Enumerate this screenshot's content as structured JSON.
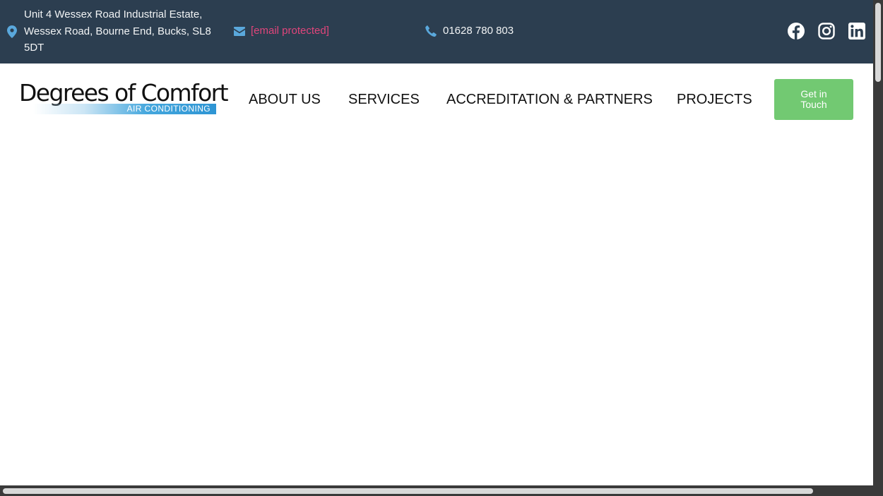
{
  "topbar": {
    "address": "Unit 4 Wessex Road Industrial Estate, Wessex Road, Bourne End, Bucks, SL8 5DT",
    "email": "[email protected]",
    "phone": "01628 780 803",
    "social": [
      "facebook-icon",
      "instagram-icon",
      "linkedin-icon"
    ]
  },
  "logo": {
    "name": "Degrees of Comfort",
    "tagline": "AIR CONDITIONING"
  },
  "nav": {
    "items": [
      "ABOUT US",
      "SERVICES",
      "ACCREDITATION & PARTNERS",
      "PROJECTS"
    ],
    "cta": "Get in Touch"
  },
  "colors": {
    "topbar_bg": "#2c3e50",
    "email_link": "#e0457b",
    "icon_accent": "#5aa8dc",
    "cta_bg": "#72c972"
  }
}
